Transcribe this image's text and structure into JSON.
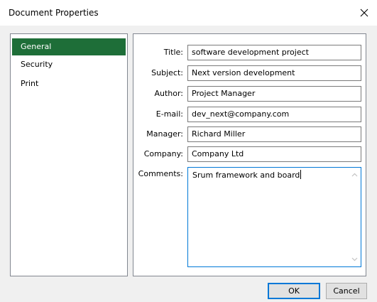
{
  "window": {
    "title": "Document Properties",
    "close_icon": "close-icon"
  },
  "sidebar": {
    "items": [
      {
        "label": "General",
        "selected": true
      },
      {
        "label": "Security",
        "selected": false
      },
      {
        "label": "Print",
        "selected": false
      }
    ]
  },
  "form": {
    "title": {
      "label": "Title:",
      "value": "software development project"
    },
    "subject": {
      "label": "Subject:",
      "value": "Next version development"
    },
    "author": {
      "label": "Author:",
      "value": "Project Manager"
    },
    "email": {
      "label": "E-mail:",
      "value": "dev_next@company.com"
    },
    "manager": {
      "label": "Manager:",
      "value": "Richard Miller"
    },
    "company": {
      "label": "Company:",
      "value": "Company Ltd"
    },
    "comments": {
      "label": "Comments:",
      "value": "Srum framework and board"
    }
  },
  "buttons": {
    "ok": "OK",
    "cancel": "Cancel"
  },
  "colors": {
    "accent": "#1e6e38",
    "focus": "#0078d7"
  }
}
